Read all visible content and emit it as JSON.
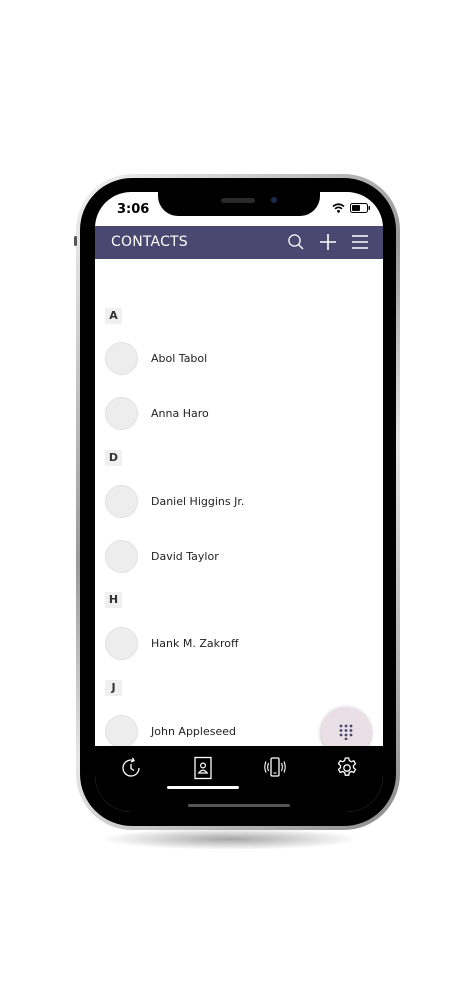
{
  "status_bar": {
    "time": "3:06"
  },
  "header": {
    "title": "CONTACTS",
    "icons": [
      "search-icon",
      "plus-icon",
      "menu-icon"
    ]
  },
  "contacts": {
    "sections": [
      {
        "letter": "A",
        "names": [
          "Abol Tabol",
          "Anna Haro"
        ]
      },
      {
        "letter": "D",
        "names": [
          "Daniel Higgins Jr.",
          "David Taylor"
        ]
      },
      {
        "letter": "H",
        "names": [
          "Hank M. Zakroff"
        ]
      },
      {
        "letter": "J",
        "names": [
          "John Appleseed"
        ]
      }
    ]
  },
  "fab": {
    "icon": "dialpad-icon"
  },
  "tabs": [
    {
      "icon": "recents-icon",
      "selected": false
    },
    {
      "icon": "contacts-book-icon",
      "selected": true
    },
    {
      "icon": "phone-ringing-icon",
      "selected": false
    },
    {
      "icon": "settings-gear-icon",
      "selected": false
    }
  ],
  "colors": {
    "header": "#4a4771",
    "fab": "#eadfe7",
    "tabbar": "#000000"
  }
}
